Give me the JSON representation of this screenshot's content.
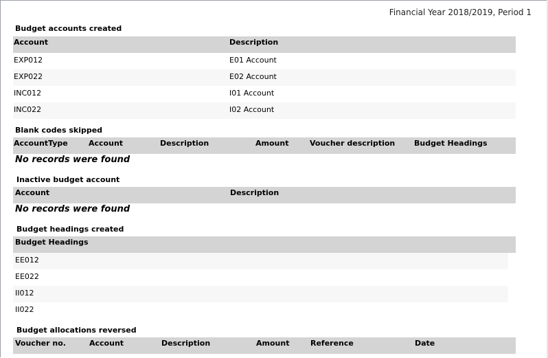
{
  "header": {
    "period": "Financial Year 2018/2019, Period 1"
  },
  "budget_accounts_created": {
    "title": "Budget accounts created",
    "columns": [
      "Account",
      "Description"
    ],
    "rows": [
      [
        "EXP012",
        "E01 Account"
      ],
      [
        "EXP022",
        "E02 Account"
      ],
      [
        "INC012",
        "I01 Account"
      ],
      [
        "INC022",
        "I02 Account"
      ]
    ]
  },
  "blank_codes_skipped": {
    "title": "Blank codes skipped",
    "columns": [
      "AccountType",
      "Account",
      "Description",
      "Amount",
      "Voucher description",
      "Budget Headings"
    ],
    "empty_message": "No records were found"
  },
  "inactive_budget_account": {
    "title": "Inactive budget account",
    "columns": [
      "Account",
      "Description"
    ],
    "empty_message": "No records were found"
  },
  "budget_headings_created": {
    "title": "Budget headings created",
    "columns": [
      "Budget Headings"
    ],
    "rows": [
      "EE012",
      "EE022",
      "II012",
      "II022"
    ]
  },
  "budget_allocations_reversed": {
    "title": "Budget allocations reversed",
    "columns": [
      "Voucher no.",
      "Account",
      "Description",
      "Amount",
      "Reference",
      "Date"
    ]
  }
}
